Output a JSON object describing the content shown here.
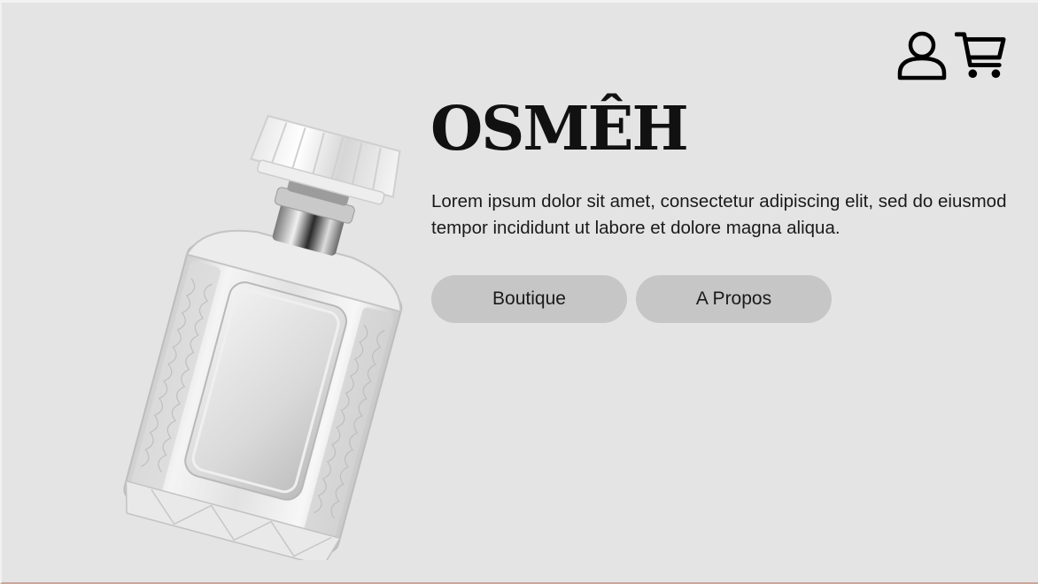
{
  "brand": {
    "title": "OSMÊH"
  },
  "hero": {
    "description": "Lorem ipsum dolor sit amet, consectetur adipiscing elit, sed do eiusmod tempor incididunt ut labore et dolore magna aliqua."
  },
  "buttons": {
    "boutique_label": "Boutique",
    "about_label": "A Propos"
  },
  "header_icons": [
    "user-icon",
    "cart-icon"
  ],
  "colors": {
    "background": "#e4e4e4",
    "button_bg": "#c6c6c6",
    "text": "#111111",
    "bottom_border": "#c9a79c"
  }
}
